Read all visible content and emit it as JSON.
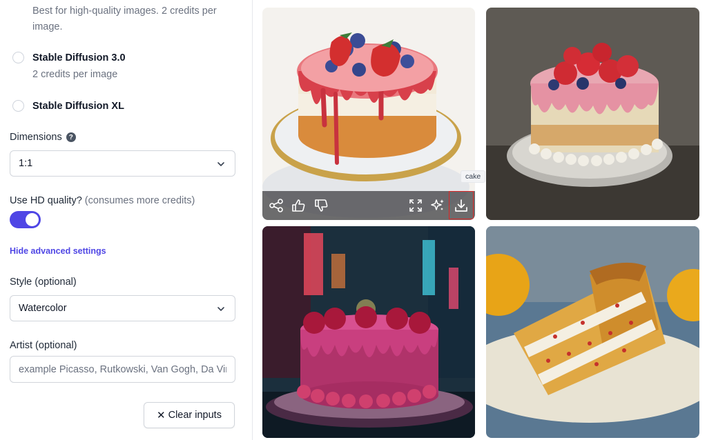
{
  "settings": {
    "model_desc_line1": "Best for high-quality images. 2 credits per",
    "model_desc_line2": "image.",
    "models": [
      {
        "label": "Stable Diffusion 3.0",
        "desc": "2 credits per image"
      },
      {
        "label": "Stable Diffusion XL"
      }
    ],
    "dimensions": {
      "label": "Dimensions",
      "help": "?",
      "value": "1:1"
    },
    "hd": {
      "label": "Use HD quality?",
      "hint": "(consumes more credits)",
      "enabled": true
    },
    "advanced_link": "Hide advanced settings",
    "style": {
      "label": "Style (optional)",
      "value": "Watercolor"
    },
    "artist": {
      "label": "Artist (optional)",
      "placeholder": "example Picasso, Rutkowski, Van Gogh, Da Vinci"
    },
    "clear_button": {
      "icon": "✕",
      "label": "Clear inputs"
    }
  },
  "results": {
    "images": [
      {
        "subject": "watercolor cake with strawberries and blueberries",
        "selected": true
      },
      {
        "subject": "oil painting cake with strawberries"
      },
      {
        "subject": "neon city cake"
      },
      {
        "subject": "oil painting cake slice with lemons"
      }
    ],
    "tooltip": "cake",
    "toolbar_icons": [
      "share-icon",
      "thumbs-up-icon",
      "thumbs-down-icon",
      "expand-icon",
      "sparkles-icon",
      "download-icon"
    ]
  },
  "colors": {
    "accent": "#4f46e5",
    "highlight": "#dc2626"
  }
}
